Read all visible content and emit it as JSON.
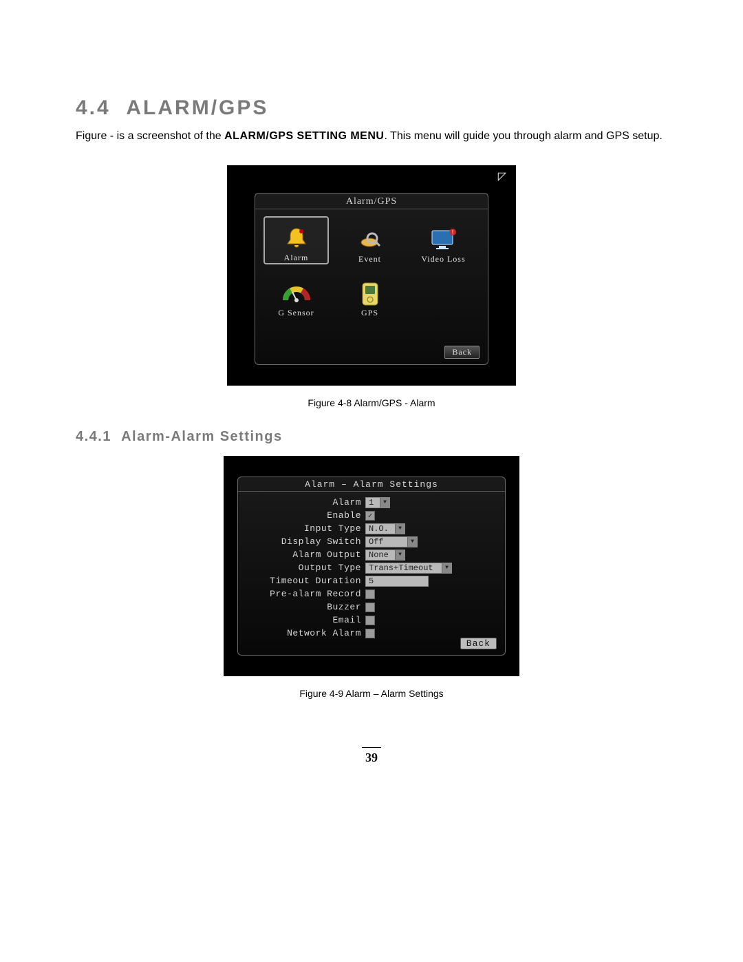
{
  "section": {
    "number": "4.4",
    "title": "ALARM/GPS",
    "intro_before": "Figure - is a screenshot of the ",
    "intro_bold": "ALARM/GPS SETTING MENU",
    "intro_after": ". This menu will guide you through alarm and GPS setup."
  },
  "figure1": {
    "caption": "Figure 4-8 Alarm/GPS - Alarm",
    "panel_title": "Alarm/GPS",
    "back_label": "Back",
    "menu_items": [
      {
        "label": "Alarm",
        "icon": "bell-icon",
        "selected": true
      },
      {
        "label": "Event",
        "icon": "search-icon",
        "selected": false
      },
      {
        "label": "Video Loss",
        "icon": "monitor-icon",
        "selected": false
      },
      {
        "label": "G Sensor",
        "icon": "gauge-icon",
        "selected": false
      },
      {
        "label": "GPS",
        "icon": "device-icon",
        "selected": false
      }
    ]
  },
  "subsection": {
    "number": "4.4.1",
    "title": "Alarm-Alarm Settings"
  },
  "figure2": {
    "caption": "Figure 4-9 Alarm – Alarm Settings",
    "panel_title": "Alarm – Alarm Settings",
    "back_label": "Back",
    "fields": {
      "alarm": {
        "label": "Alarm",
        "type": "dropdown",
        "value": "1",
        "size": "sm"
      },
      "enable": {
        "label": "Enable",
        "type": "checkbox",
        "checked": true
      },
      "input_type": {
        "label": "Input Type",
        "type": "dropdown",
        "value": "N.O.",
        "size": "md"
      },
      "display_switch": {
        "label": "Display Switch",
        "type": "dropdown",
        "value": "Off",
        "size": "lg"
      },
      "alarm_output": {
        "label": "Alarm Output",
        "type": "dropdown",
        "value": "None",
        "size": "md"
      },
      "output_type": {
        "label": "Output Type",
        "type": "dropdown",
        "value": "Trans+Timeout",
        "size": "xl"
      },
      "timeout_duration": {
        "label": "Timeout Duration",
        "type": "text",
        "value": "5"
      },
      "prealarm_record": {
        "label": "Pre-alarm Record",
        "type": "checkbox",
        "checked": false
      },
      "buzzer": {
        "label": "Buzzer",
        "type": "checkbox",
        "checked": false
      },
      "email": {
        "label": "Email",
        "type": "checkbox",
        "checked": false
      },
      "network_alarm": {
        "label": "Network Alarm",
        "type": "checkbox",
        "checked": false
      }
    },
    "field_order": [
      "alarm",
      "enable",
      "input_type",
      "display_switch",
      "alarm_output",
      "output_type",
      "timeout_duration",
      "prealarm_record",
      "buzzer",
      "email",
      "network_alarm"
    ]
  },
  "page_number": "39"
}
